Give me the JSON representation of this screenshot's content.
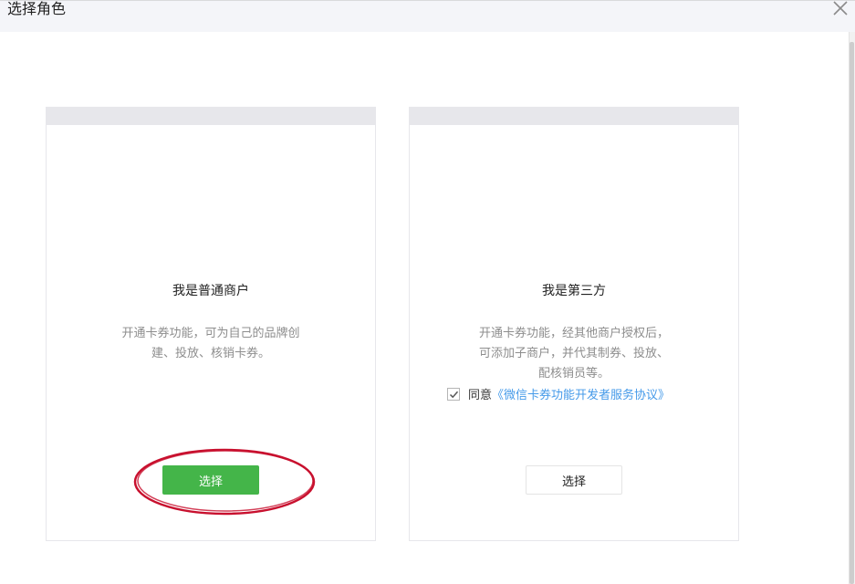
{
  "dialog": {
    "title": "选择角色"
  },
  "cards": [
    {
      "title": "我是普通商户",
      "desc_lines": [
        "开通卡券功能，可为自己的品牌创",
        "建、投放、核销卡券。"
      ],
      "button_label": "选择"
    },
    {
      "title": "我是第三方",
      "desc_lines": [
        "开通卡券功能，经其他商户授权后，",
        "可添加子商户，并代其制券、投放、",
        "配核销员等。"
      ],
      "agree_text": "同意",
      "agree_link": "《微信卡券功能开发者服务协议》",
      "agree_checked": true,
      "button_label": "选择"
    }
  ],
  "colors": {
    "primary_button": "#44b549",
    "link": "#459ae9",
    "annotation_circle": "#c8102e"
  },
  "icons": {
    "close": "close-icon",
    "check": "check-icon"
  }
}
